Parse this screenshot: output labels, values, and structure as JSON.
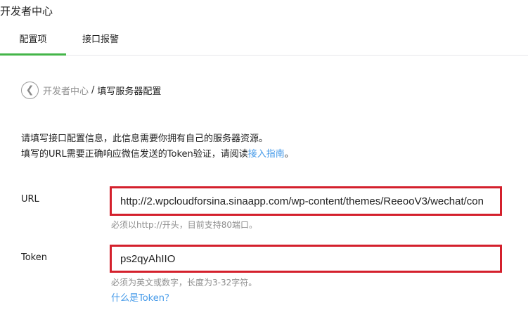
{
  "header": {
    "title": "开发者中心"
  },
  "tabs": [
    {
      "label": "配置项",
      "active": true
    },
    {
      "label": "接口报警",
      "active": false
    }
  ],
  "breadcrumb": {
    "back_icon": "chevron-left-icon",
    "parent": "开发者中心",
    "separator": "/",
    "current": "填写服务器配置"
  },
  "description": {
    "line1": "请填写接口配置信息，此信息需要你拥有自己的服务器资源。",
    "line2_prefix": "填写的URL需要正确响应微信发送的Token验证，请阅读",
    "line2_link": "接入指南",
    "line2_suffix": "。"
  },
  "form": {
    "url": {
      "label": "URL",
      "value": "http://2.wpcloudforsina.sinaapp.com/wp-content/themes/ReeooV3/wechat/con",
      "hint": "必须以http://开头，目前支持80端口。"
    },
    "token": {
      "label": "Token",
      "value": "ps2qyAhIIO",
      "hint": "必须为英文或数字，长度为3-32字符。",
      "help_link": "什么是Token？"
    }
  },
  "colors": {
    "accent_green": "#44b549",
    "link_blue": "#459ae9",
    "highlight_red": "#d4202c",
    "muted_gray": "#8d8d8d"
  }
}
